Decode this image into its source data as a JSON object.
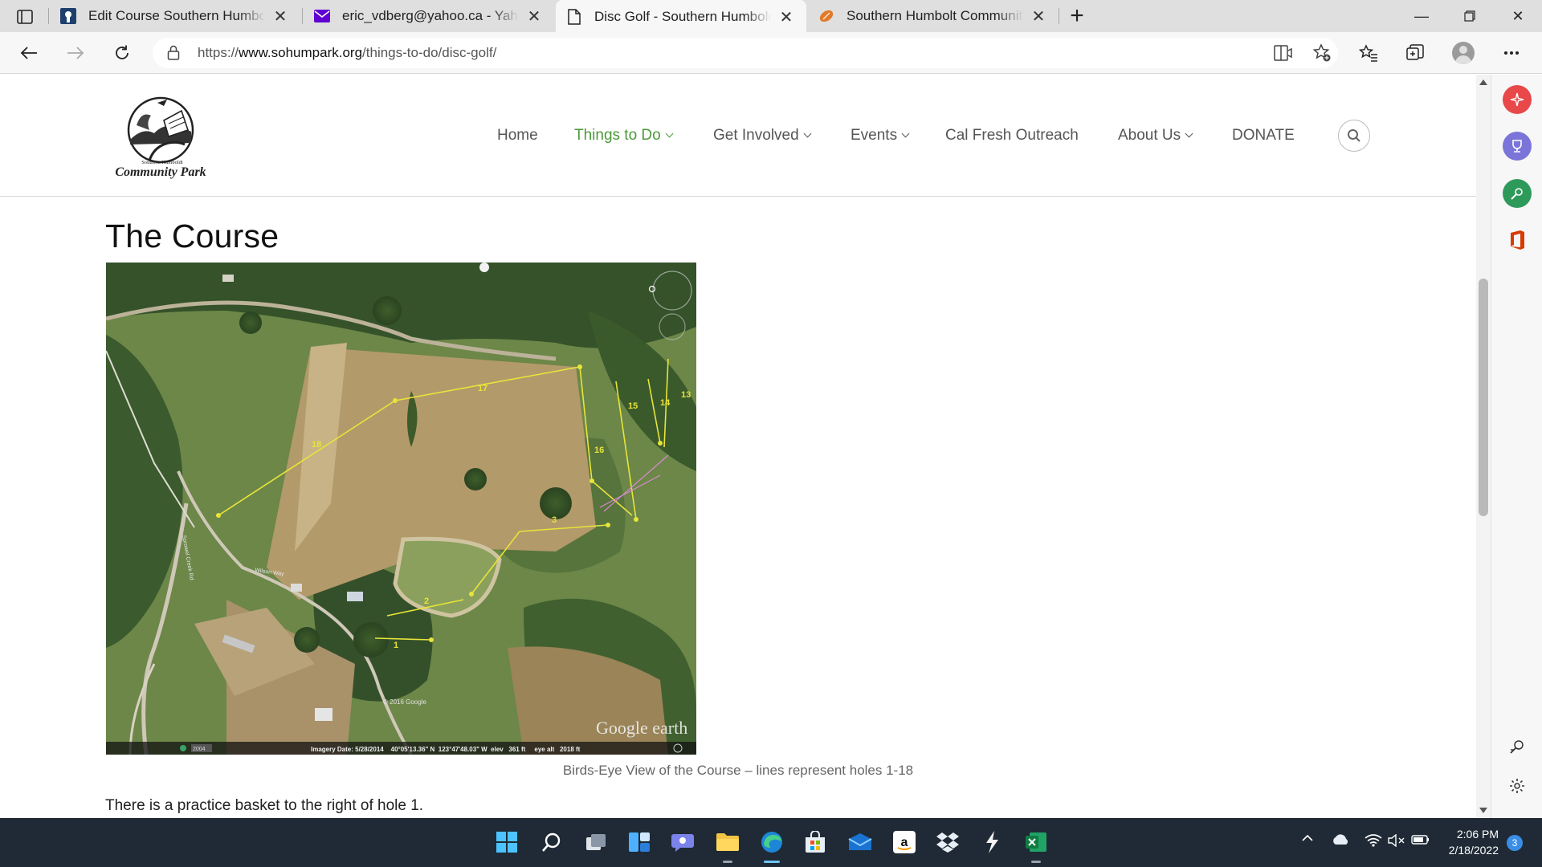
{
  "browser": {
    "tabs": [
      {
        "title": "Edit Course Southern Humboldt",
        "icon": "discgolf-favicon",
        "active": false
      },
      {
        "title": "eric_vdberg@yahoo.ca - Yahoo Mail",
        "icon": "mail-icon",
        "active": false
      },
      {
        "title": "Disc Golf - Southern Humboldt Community Park",
        "icon": "page-icon",
        "active": true
      },
      {
        "title": "Southern Humbolt Community Park",
        "icon": "football-icon",
        "active": false
      }
    ],
    "url": {
      "scheme": "https://",
      "host": "www.sohumpark.org",
      "path": "/things-to-do/disc-golf/"
    }
  },
  "site": {
    "logo_text_1": "Southern Humboldt",
    "logo_text_2": "Community Park",
    "menu": [
      {
        "label": "Home",
        "dropdown": false,
        "current": false
      },
      {
        "label": "Things to Do",
        "dropdown": true,
        "current": true
      },
      {
        "label": "Get Involved",
        "dropdown": true,
        "current": false
      },
      {
        "label": "Events",
        "dropdown": true,
        "current": false
      },
      {
        "label": "Cal Fresh Outreach",
        "dropdown": false,
        "current": false
      },
      {
        "label": "About Us",
        "dropdown": true,
        "current": false
      },
      {
        "label": "DONATE",
        "dropdown": false,
        "current": false
      }
    ],
    "accent_color": "#4a9a3a"
  },
  "content": {
    "heading": "The Course",
    "map": {
      "hole_labels": [
        "1",
        "2",
        "3",
        "13",
        "14",
        "15",
        "16",
        "17",
        "18"
      ],
      "watermark": "Google earth",
      "copyright": "© 2016 Google",
      "road_label": "Wilson Way",
      "road_label_2": "Sprowel Creek Rd",
      "year_badge": "2004",
      "status_bar": "Imagery Date: 5/28/2014    40°05'13.36\" N  123°47'48.03\" W  elev   361 ft     eye alt   2018 ft"
    },
    "caption": "Birds-Eye View of the Course – lines represent holes 1-18",
    "body": "There is a practice basket to the right of hole 1."
  },
  "taskbar": {
    "time": "2:06 PM",
    "date": "2/18/2022",
    "notifications": "3"
  }
}
